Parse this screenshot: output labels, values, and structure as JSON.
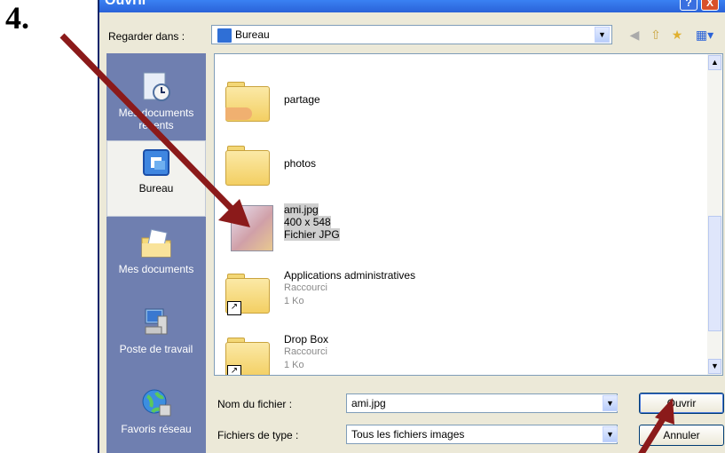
{
  "step_number": "4.",
  "window": {
    "title": "Ouvrir",
    "help": "?",
    "close": "X"
  },
  "look_in": {
    "label": "Regarder dans :",
    "value": "Bureau"
  },
  "places": [
    {
      "label": "Mes documents récents"
    },
    {
      "label": "Bureau"
    },
    {
      "label": "Mes documents"
    },
    {
      "label": "Poste de travail"
    },
    {
      "label": "Favoris réseau"
    }
  ],
  "files": [
    {
      "name": "partage",
      "type": "folder"
    },
    {
      "name": "photos",
      "type": "folder"
    },
    {
      "name": "ami.jpg",
      "dims": "400 x 548",
      "kind": "Fichier JPG",
      "type": "image"
    },
    {
      "name": "Applications administratives",
      "kind": "Raccourci",
      "size": "1 Ko",
      "type": "shortcut"
    },
    {
      "name": "Drop Box",
      "kind": "Raccourci",
      "size": "1 Ko",
      "type": "shortcut"
    }
  ],
  "filename": {
    "label": "Nom du fichier :",
    "value": "ami.jpg"
  },
  "filetype": {
    "label": "Fichiers de type :",
    "value": "Tous les fichiers images"
  },
  "buttons": {
    "open": "Ouvrir",
    "cancel": "Annuler"
  },
  "colors": {
    "arrow": "#8b1a1a",
    "places_bg": "#6f7fb0",
    "dialog_bg": "#ece9d8"
  }
}
